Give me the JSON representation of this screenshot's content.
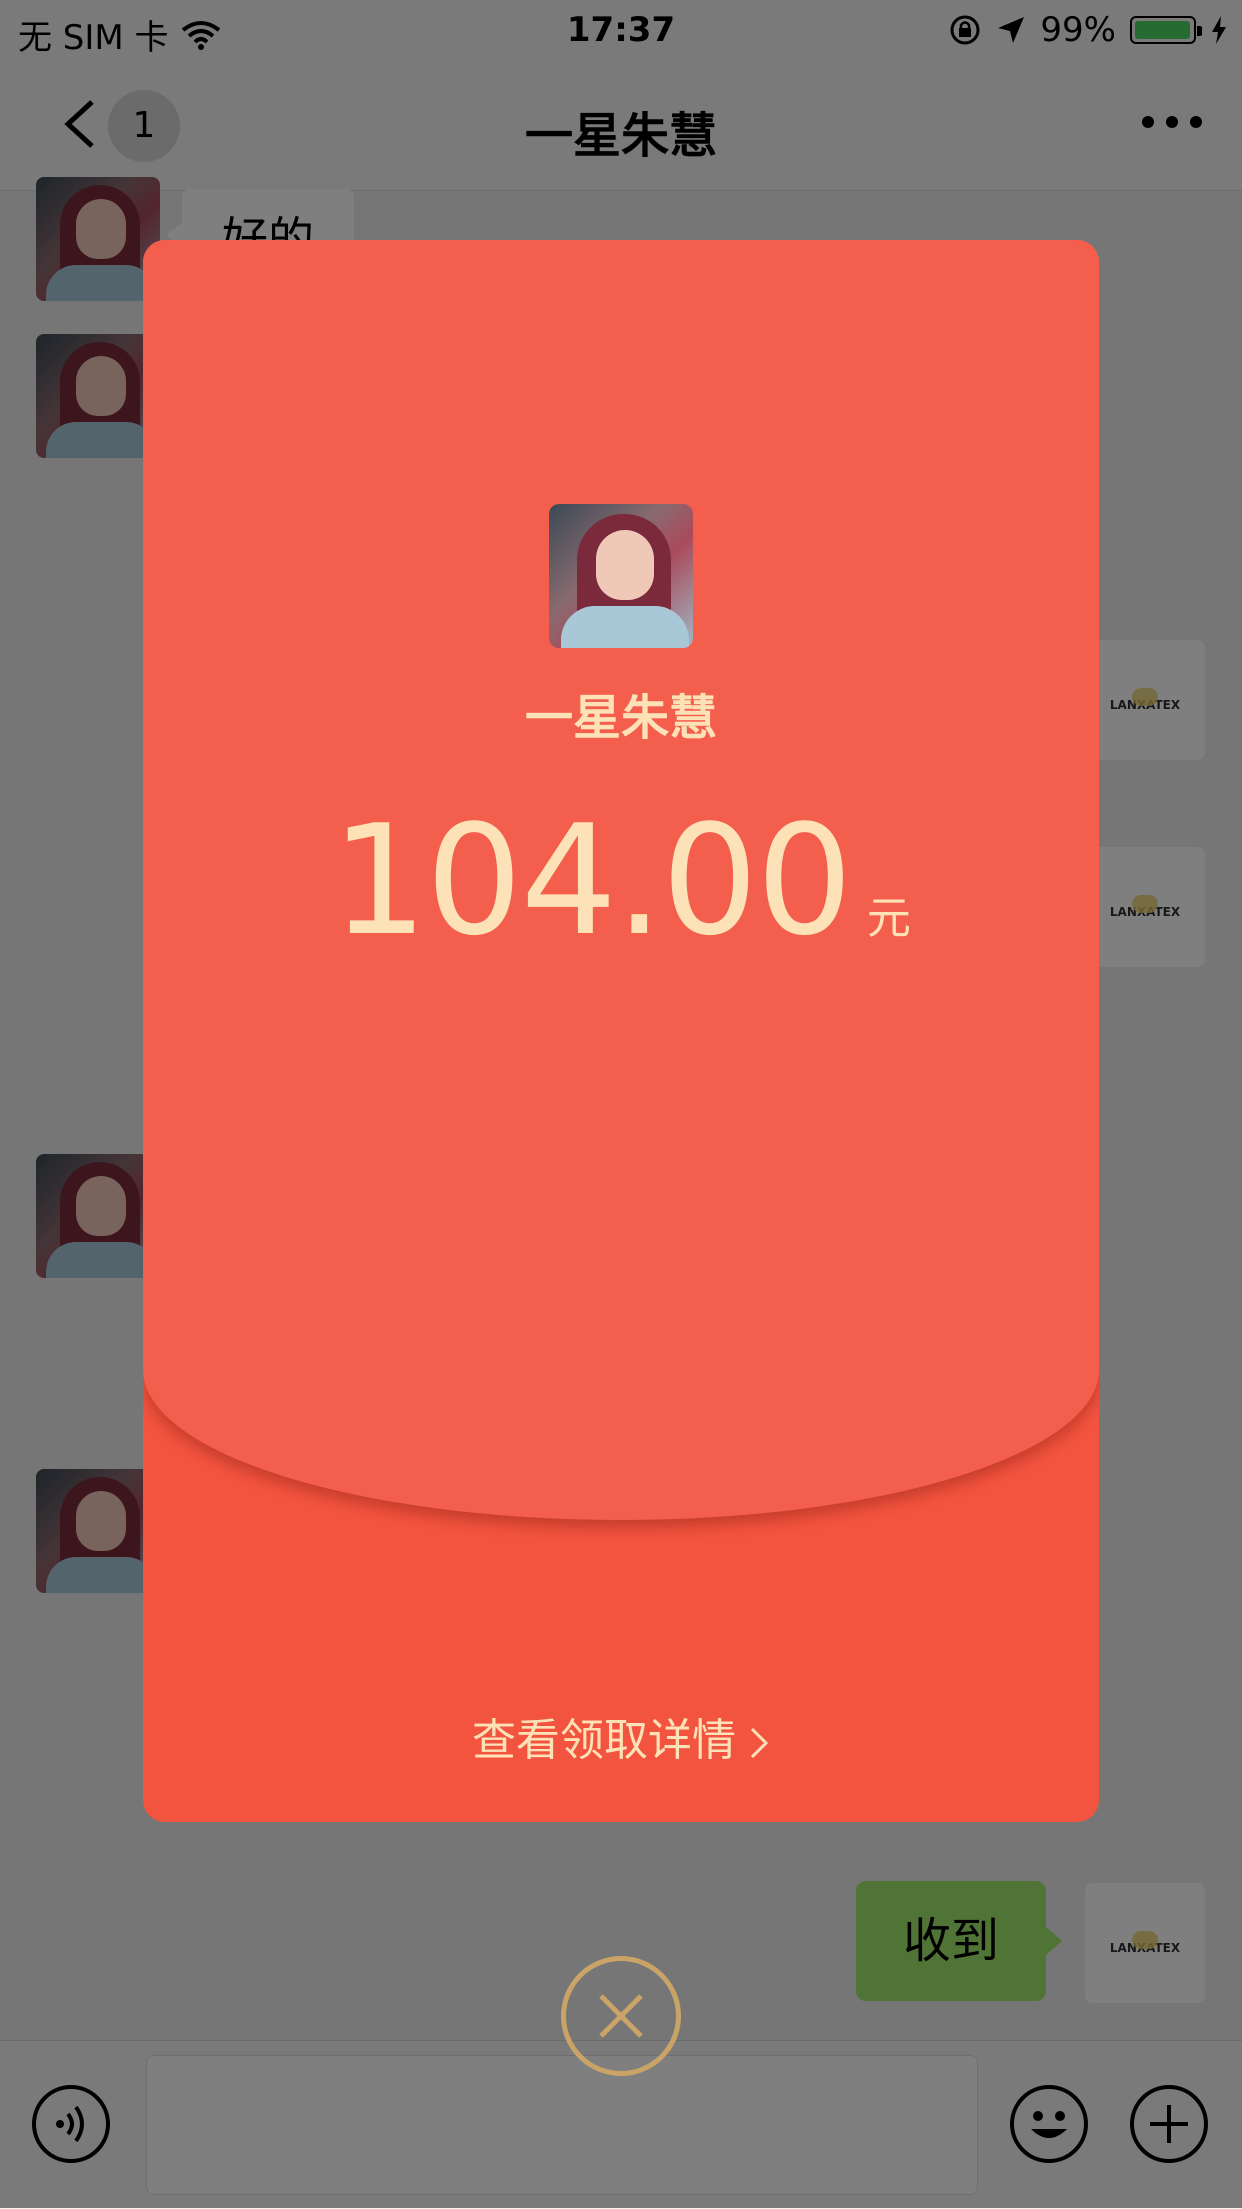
{
  "status_bar": {
    "carrier": "无 SIM 卡",
    "time": "17:37",
    "battery_percent": "99%",
    "battery_level": 0.99,
    "battery_color": "#4cd964"
  },
  "nav": {
    "title": "一星朱慧",
    "unread_count": "1"
  },
  "chat": {
    "incoming_text": "好的",
    "outgoing_text": "收到",
    "logo_label": "LANXATEX"
  },
  "red_packet": {
    "sender": "一星朱慧",
    "amount": "104.00",
    "currency": "元",
    "details_label": "查看领取详情",
    "background_color": "#f35f4c",
    "text_color": "#fde2b8"
  },
  "icons": {
    "back": "chevron-left-icon",
    "more": "more-icon",
    "voice": "voice-icon",
    "emoji": "emoji-icon",
    "add": "plus-icon",
    "close": "close-icon"
  }
}
